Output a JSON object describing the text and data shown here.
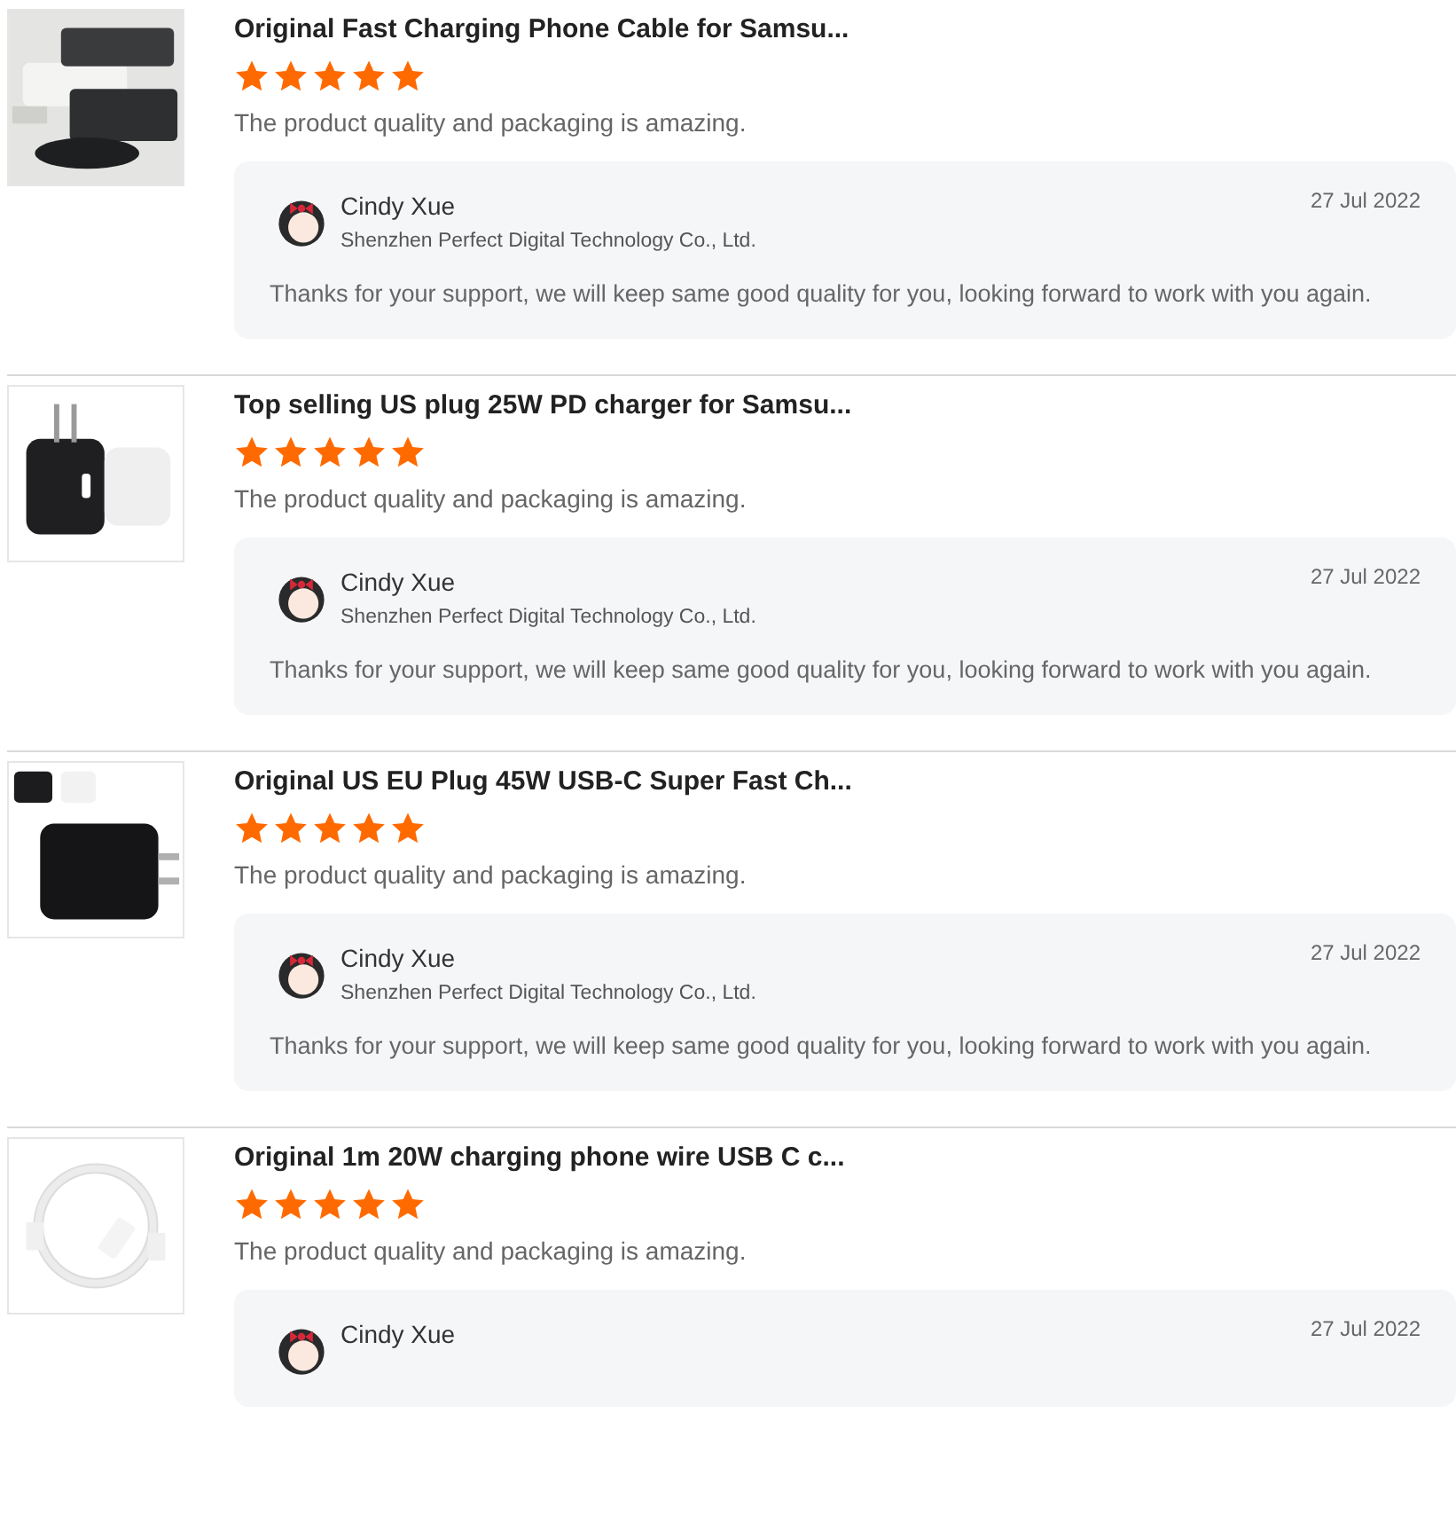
{
  "reviews": [
    {
      "product_title": "Original Fast Charging Phone Cable for Samsu...",
      "stars": 5,
      "comment": "The product quality and packaging is amazing.",
      "reply": {
        "name": "Cindy Xue",
        "company": "Shenzhen Perfect Digital Technology Co., Ltd.",
        "date": "27 Jul 2022",
        "text": "Thanks for your support, we will keep same good quality for you, looking forward to work with you again."
      }
    },
    {
      "product_title": "Top selling US plug 25W PD charger for Samsu...",
      "stars": 5,
      "comment": "The product quality and packaging is amazing.",
      "reply": {
        "name": "Cindy Xue",
        "company": "Shenzhen Perfect Digital Technology Co., Ltd.",
        "date": "27 Jul 2022",
        "text": "Thanks for your support, we will keep same good quality for you, looking forward to work with you again."
      }
    },
    {
      "product_title": "Original US EU Plug 45W USB-C Super Fast Ch...",
      "stars": 5,
      "comment": "The product quality and packaging is amazing.",
      "reply": {
        "name": "Cindy Xue",
        "company": "Shenzhen Perfect Digital Technology Co., Ltd.",
        "date": "27 Jul 2022",
        "text": "Thanks for your support, we will keep same good quality for you, looking forward to work with you again."
      }
    },
    {
      "product_title": "Original 1m 20W charging phone wire USB C c...",
      "stars": 5,
      "comment": "The product quality and packaging is amazing.",
      "reply": {
        "name": "Cindy Xue",
        "date": "27 Jul 2022"
      }
    }
  ]
}
